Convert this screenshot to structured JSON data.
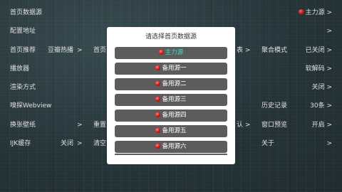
{
  "settings": {
    "rows": [
      {
        "label": "首页数据源",
        "value": "主力源",
        "has_dot": true
      },
      {
        "label": "配置地址"
      },
      {
        "label": "首页推荐",
        "col2": "豆瓣热播",
        "col2_arrow": ">",
        "col3": "首页",
        "col4_tail": "表 >",
        "col5": "聚合模式",
        "col6": "已关闭 >"
      },
      {
        "label": "播放器",
        "col6": "软解码 >"
      },
      {
        "label": "渲染方式",
        "col6": "关闭 >"
      },
      {
        "label": "嗅探Webview",
        "col5": "历史记录",
        "col6": "30条 >"
      },
      {
        "label": "换张壁纸",
        "col2_arrow": ">",
        "col3": "重置",
        "col4_tail": "认 >",
        "col5": "窗口预览",
        "col6": "开启 >"
      },
      {
        "label": "IJK缓存",
        "col2": "关闭",
        "col2_arrow": ">",
        "col3": "清空",
        "col5": "关于",
        "col6": ">"
      }
    ]
  },
  "dialog": {
    "title": "请选择首页数据源",
    "options": [
      "主力源",
      "备用源一",
      "备用源二",
      "备用源三",
      "备用源四",
      "备用源五",
      "备用源六"
    ],
    "selected_index": 0,
    "selected_color": "#39e0c0"
  },
  "colors": {
    "text": "#ffffff",
    "option_bg": "#5c5c5c",
    "dialog_bg": "#ffffff",
    "dot": "#e02020"
  }
}
